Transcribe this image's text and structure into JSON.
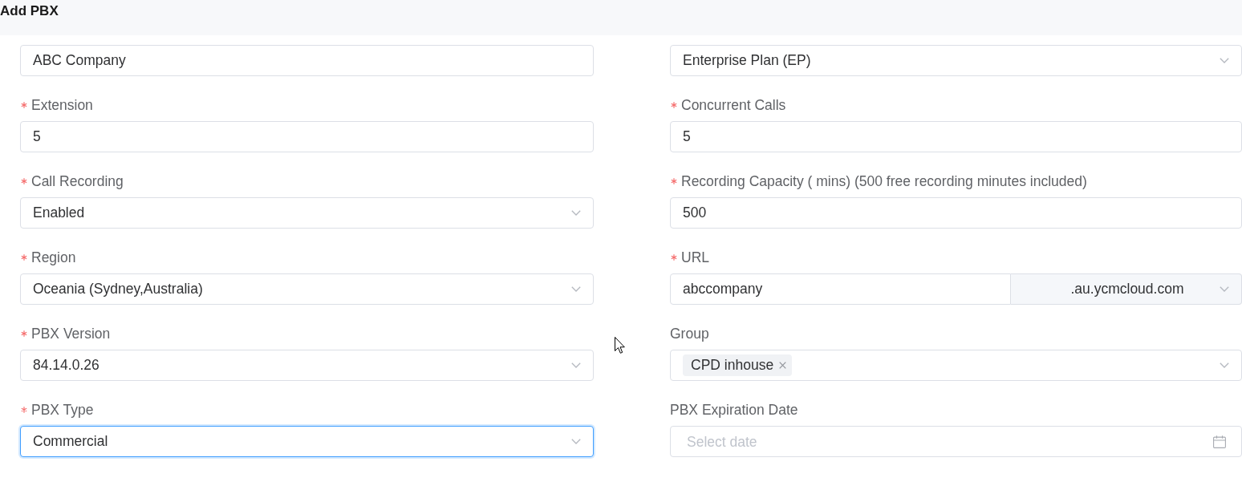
{
  "header": {
    "title": "Add PBX"
  },
  "fields": [
    {
      "kind": "text",
      "focused": false,
      "value": "ABC Company"
    },
    {
      "kind": "select",
      "focused": false,
      "value": "Enterprise Plan (EP)"
    },
    {
      "kind": "text",
      "label": "Extension",
      "required": true,
      "focused": false,
      "value": "5"
    },
    {
      "kind": "text",
      "label": "Concurrent Calls",
      "required": true,
      "focused": false,
      "value": "5"
    },
    {
      "kind": "select",
      "label": "Call Recording",
      "required": true,
      "focused": false,
      "value": "Enabled"
    },
    {
      "kind": "text",
      "label": "Recording Capacity ( mins) (500 free recording minutes included)",
      "required": true,
      "focused": false,
      "value": "500"
    },
    {
      "kind": "select",
      "label": "Region",
      "required": true,
      "focused": false,
      "value": "Oceania (Sydney,Australia)"
    },
    {
      "kind": "url",
      "label": "URL",
      "required": true,
      "focused": false,
      "value": "abccompany",
      "suffix": ".au.ycmcloud.com"
    },
    {
      "kind": "select",
      "label": "PBX Version",
      "required": true,
      "focused": false,
      "value": "84.14.0.26"
    },
    {
      "kind": "tags",
      "label": "Group",
      "required": false,
      "focused": false,
      "tags": [
        {
          "label": "CPD inhouse"
        }
      ]
    },
    {
      "kind": "select",
      "label": "PBX Type",
      "required": true,
      "focused": true,
      "value": "Commercial"
    },
    {
      "kind": "date",
      "label": "PBX Expiration Date",
      "required": false,
      "focused": false,
      "placeholder": "Select date"
    }
  ]
}
